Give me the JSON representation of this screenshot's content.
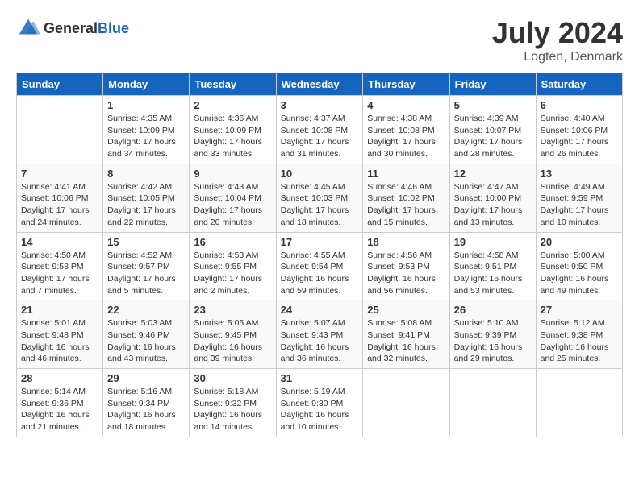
{
  "header": {
    "logo_general": "General",
    "logo_blue": "Blue",
    "title": "July 2024",
    "location": "Logten, Denmark"
  },
  "days_of_week": [
    "Sunday",
    "Monday",
    "Tuesday",
    "Wednesday",
    "Thursday",
    "Friday",
    "Saturday"
  ],
  "weeks": [
    [
      {
        "day": "",
        "info": ""
      },
      {
        "day": "1",
        "info": "Sunrise: 4:35 AM\nSunset: 10:09 PM\nDaylight: 17 hours\nand 34 minutes."
      },
      {
        "day": "2",
        "info": "Sunrise: 4:36 AM\nSunset: 10:09 PM\nDaylight: 17 hours\nand 33 minutes."
      },
      {
        "day": "3",
        "info": "Sunrise: 4:37 AM\nSunset: 10:08 PM\nDaylight: 17 hours\nand 31 minutes."
      },
      {
        "day": "4",
        "info": "Sunrise: 4:38 AM\nSunset: 10:08 PM\nDaylight: 17 hours\nand 30 minutes."
      },
      {
        "day": "5",
        "info": "Sunrise: 4:39 AM\nSunset: 10:07 PM\nDaylight: 17 hours\nand 28 minutes."
      },
      {
        "day": "6",
        "info": "Sunrise: 4:40 AM\nSunset: 10:06 PM\nDaylight: 17 hours\nand 26 minutes."
      }
    ],
    [
      {
        "day": "7",
        "info": "Sunrise: 4:41 AM\nSunset: 10:06 PM\nDaylight: 17 hours\nand 24 minutes."
      },
      {
        "day": "8",
        "info": "Sunrise: 4:42 AM\nSunset: 10:05 PM\nDaylight: 17 hours\nand 22 minutes."
      },
      {
        "day": "9",
        "info": "Sunrise: 4:43 AM\nSunset: 10:04 PM\nDaylight: 17 hours\nand 20 minutes."
      },
      {
        "day": "10",
        "info": "Sunrise: 4:45 AM\nSunset: 10:03 PM\nDaylight: 17 hours\nand 18 minutes."
      },
      {
        "day": "11",
        "info": "Sunrise: 4:46 AM\nSunset: 10:02 PM\nDaylight: 17 hours\nand 15 minutes."
      },
      {
        "day": "12",
        "info": "Sunrise: 4:47 AM\nSunset: 10:00 PM\nDaylight: 17 hours\nand 13 minutes."
      },
      {
        "day": "13",
        "info": "Sunrise: 4:49 AM\nSunset: 9:59 PM\nDaylight: 17 hours\nand 10 minutes."
      }
    ],
    [
      {
        "day": "14",
        "info": "Sunrise: 4:50 AM\nSunset: 9:58 PM\nDaylight: 17 hours\nand 7 minutes."
      },
      {
        "day": "15",
        "info": "Sunrise: 4:52 AM\nSunset: 9:57 PM\nDaylight: 17 hours\nand 5 minutes."
      },
      {
        "day": "16",
        "info": "Sunrise: 4:53 AM\nSunset: 9:55 PM\nDaylight: 17 hours\nand 2 minutes."
      },
      {
        "day": "17",
        "info": "Sunrise: 4:55 AM\nSunset: 9:54 PM\nDaylight: 16 hours\nand 59 minutes."
      },
      {
        "day": "18",
        "info": "Sunrise: 4:56 AM\nSunset: 9:53 PM\nDaylight: 16 hours\nand 56 minutes."
      },
      {
        "day": "19",
        "info": "Sunrise: 4:58 AM\nSunset: 9:51 PM\nDaylight: 16 hours\nand 53 minutes."
      },
      {
        "day": "20",
        "info": "Sunrise: 5:00 AM\nSunset: 9:50 PM\nDaylight: 16 hours\nand 49 minutes."
      }
    ],
    [
      {
        "day": "21",
        "info": "Sunrise: 5:01 AM\nSunset: 9:48 PM\nDaylight: 16 hours\nand 46 minutes."
      },
      {
        "day": "22",
        "info": "Sunrise: 5:03 AM\nSunset: 9:46 PM\nDaylight: 16 hours\nand 43 minutes."
      },
      {
        "day": "23",
        "info": "Sunrise: 5:05 AM\nSunset: 9:45 PM\nDaylight: 16 hours\nand 39 minutes."
      },
      {
        "day": "24",
        "info": "Sunrise: 5:07 AM\nSunset: 9:43 PM\nDaylight: 16 hours\nand 36 minutes."
      },
      {
        "day": "25",
        "info": "Sunrise: 5:08 AM\nSunset: 9:41 PM\nDaylight: 16 hours\nand 32 minutes."
      },
      {
        "day": "26",
        "info": "Sunrise: 5:10 AM\nSunset: 9:39 PM\nDaylight: 16 hours\nand 29 minutes."
      },
      {
        "day": "27",
        "info": "Sunrise: 5:12 AM\nSunset: 9:38 PM\nDaylight: 16 hours\nand 25 minutes."
      }
    ],
    [
      {
        "day": "28",
        "info": "Sunrise: 5:14 AM\nSunset: 9:36 PM\nDaylight: 16 hours\nand 21 minutes."
      },
      {
        "day": "29",
        "info": "Sunrise: 5:16 AM\nSunset: 9:34 PM\nDaylight: 16 hours\nand 18 minutes."
      },
      {
        "day": "30",
        "info": "Sunrise: 5:18 AM\nSunset: 9:32 PM\nDaylight: 16 hours\nand 14 minutes."
      },
      {
        "day": "31",
        "info": "Sunrise: 5:19 AM\nSunset: 9:30 PM\nDaylight: 16 hours\nand 10 minutes."
      },
      {
        "day": "",
        "info": ""
      },
      {
        "day": "",
        "info": ""
      },
      {
        "day": "",
        "info": ""
      }
    ]
  ]
}
